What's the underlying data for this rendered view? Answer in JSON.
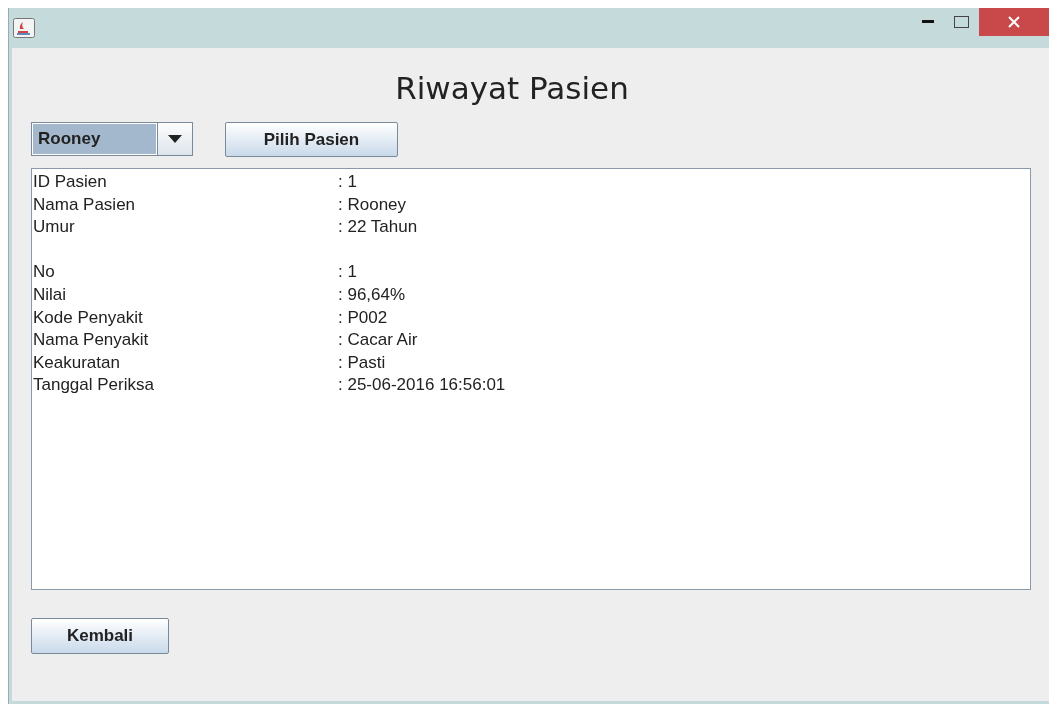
{
  "window": {
    "title": "Riwayat Pasien"
  },
  "patient_select": {
    "value": "Rooney"
  },
  "buttons": {
    "select": "Pilih Pasien",
    "back": "Kembali"
  },
  "details": [
    {
      "rows": [
        {
          "label": "ID Pasien",
          "value": ": 1"
        },
        {
          "label": "Nama Pasien",
          "value": ": Rooney"
        },
        {
          "label": "Umur",
          "value": ": 22 Tahun"
        }
      ]
    },
    {
      "rows": [
        {
          "label": "No",
          "value": ": 1"
        },
        {
          "label": "Nilai",
          "value": ": 96,64%"
        },
        {
          "label": "Kode Penyakit",
          "value": ": P002"
        },
        {
          "label": "Nama Penyakit",
          "value": ": Cacar Air"
        },
        {
          "label": "Keakuratan",
          "value": ": Pasti"
        },
        {
          "label": "Tanggal Periksa",
          "value": ": 25-06-2016 16:56:01"
        }
      ]
    }
  ]
}
